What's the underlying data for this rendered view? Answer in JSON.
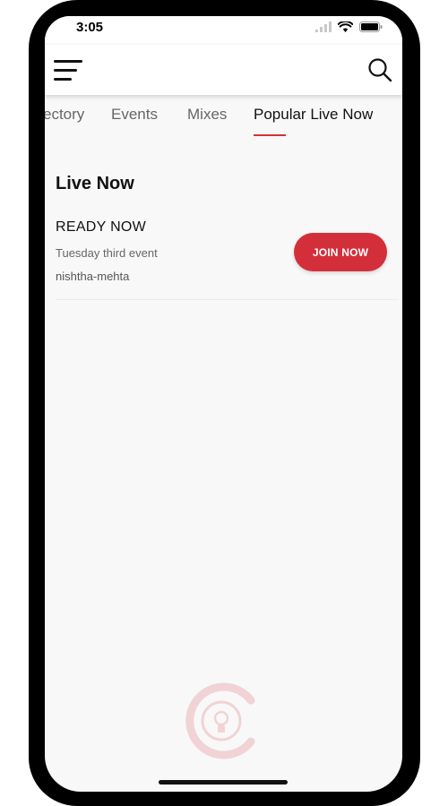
{
  "status_bar": {
    "time": "3:05",
    "icons": [
      "signal-icon",
      "wifi-icon",
      "battery-icon"
    ]
  },
  "header": {
    "menu_icon": "hamburger-menu-icon",
    "search_icon": "search-icon"
  },
  "tabs": [
    {
      "label": "ectory",
      "active": false
    },
    {
      "label": "Events",
      "active": false
    },
    {
      "label": "Mixes",
      "active": false
    },
    {
      "label": "Popular Live Now",
      "active": true
    }
  ],
  "live_now": {
    "title": "Live Now",
    "items": [
      {
        "title": "READY NOW",
        "subtitle": "Tuesday third event",
        "host": "nishtha-mehta",
        "button_label": "JOIN NOW"
      }
    ]
  },
  "colors": {
    "accent": "#d32f3a",
    "background": "#f8f8f8",
    "header_bg": "#ffffff",
    "text_primary": "#111111",
    "text_secondary": "#666666"
  },
  "watermark_icon": "brand-logo-icon"
}
